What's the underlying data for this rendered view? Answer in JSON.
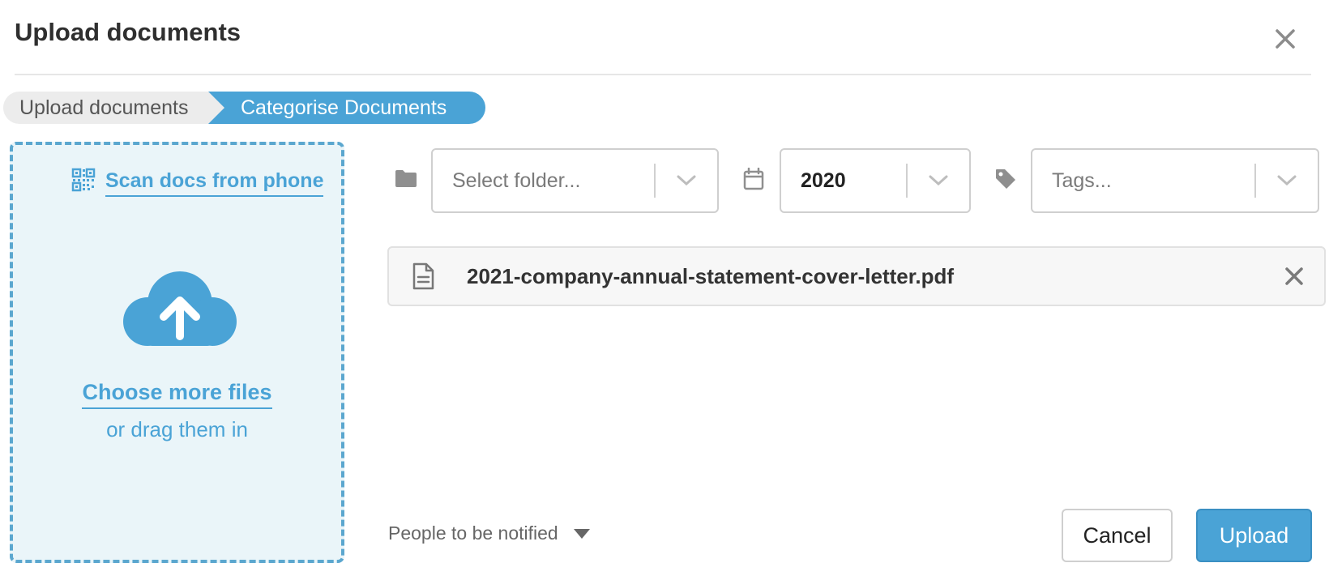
{
  "dialog": {
    "title": "Upload documents"
  },
  "steps": [
    {
      "label": "Upload documents",
      "state": "completed"
    },
    {
      "label": "Categorise Documents",
      "state": "active"
    }
  ],
  "dropzone": {
    "scan_label": "Scan docs from phone",
    "choose_label": "Choose more files",
    "drag_label": "or drag them in"
  },
  "filters": {
    "folder": {
      "icon": "folder-icon",
      "placeholder": "Select folder..."
    },
    "year": {
      "icon": "calendar-icon",
      "value": "2020"
    },
    "tags": {
      "icon": "tag-icon",
      "placeholder": "Tags..."
    }
  },
  "files": [
    {
      "name": "2021-company-annual-statement-cover-letter.pdf",
      "icon": "document-icon"
    }
  ],
  "footer": {
    "notify_label": "People to be notified",
    "cancel_label": "Cancel",
    "upload_label": "Upload"
  },
  "colors": {
    "accent": "#4aa3d6",
    "dropzone_bg": "#eaf5f9",
    "step_inactive_bg": "#ececec"
  }
}
